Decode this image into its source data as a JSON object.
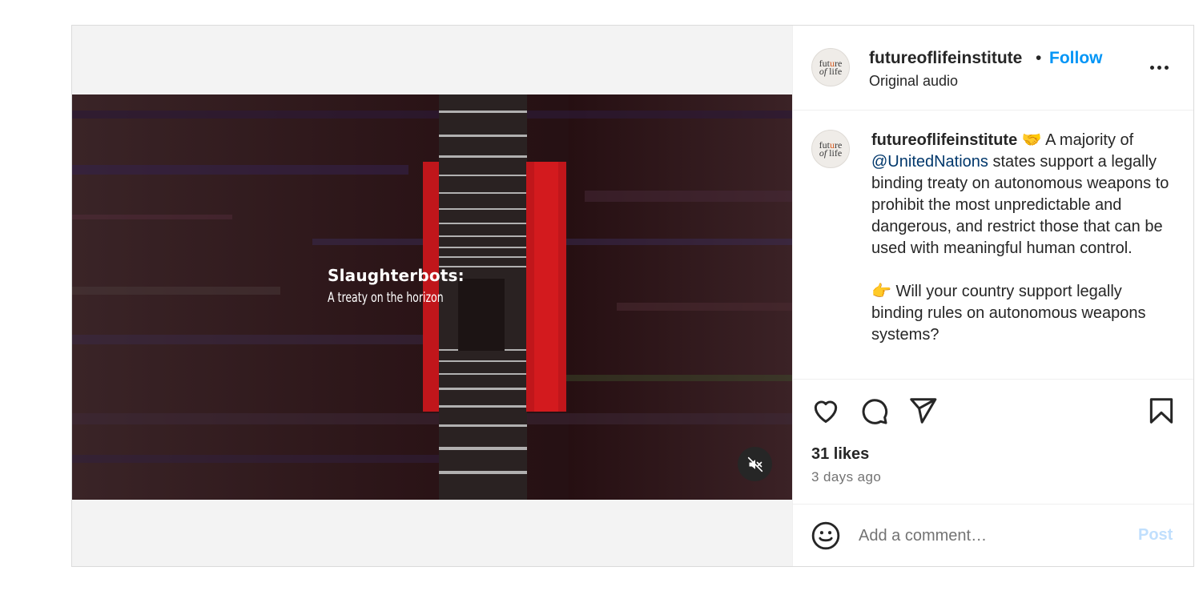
{
  "video": {
    "overlay_title": "Slaughterbots:",
    "overlay_subtitle": "A treaty on the horizon",
    "mute_icon": "speaker-muted-icon"
  },
  "header": {
    "username": "futureoflifeinstitute",
    "separator": "•",
    "follow_label": "Follow",
    "audio_label": "Original audio",
    "more_icon": "more-horizontal-icon"
  },
  "avatar": {
    "logo_line1": "fut",
    "logo_o": "u",
    "logo_line1b": "re",
    "logo_line2": "of life"
  },
  "caption": {
    "username": "futureoflifeinstitute",
    "emoji1": "🤝",
    "text_a": " A majority of ",
    "mention": "@UnitedNations",
    "text_b": " states support a legally binding treaty on autonomous weapons to prohibit the most unpredictable and dangerous, and restrict those that can be used with meaningful human control.",
    "emoji2": "👉",
    "text_c": " Will your country support legally binding rules on autonomous weapons systems?"
  },
  "actions": {
    "like_icon": "heart-icon",
    "comment_icon": "comment-icon",
    "share_icon": "paper-plane-icon",
    "save_icon": "bookmark-icon",
    "likes_text": "31 likes",
    "time_ago": "3 days ago"
  },
  "comment": {
    "emoji_icon": "smiley-icon",
    "placeholder": "Add a comment…",
    "post_label": "Post"
  },
  "colors": {
    "accent": "#0095f6",
    "mention": "#00376b",
    "post_disabled": "#c0dffd"
  }
}
